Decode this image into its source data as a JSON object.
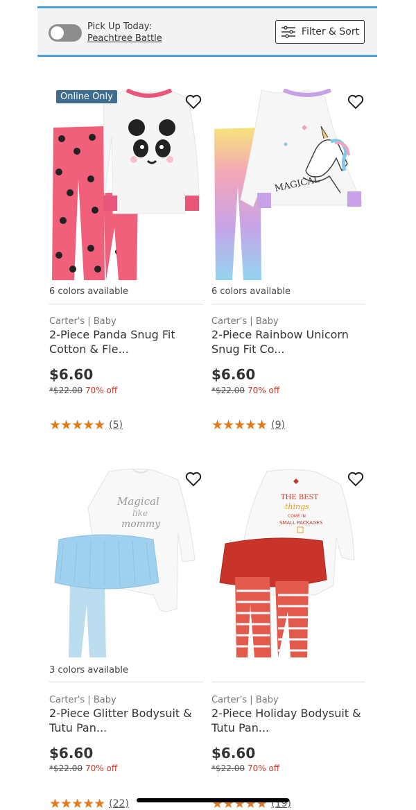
{
  "filter_bar": {
    "pickup_label": "Pick Up Today:",
    "pickup_store": "Peachtree Battle",
    "filter_label": "Filter & Sort"
  },
  "products": [
    {
      "badge": "Online Only",
      "colors": "6 colors available",
      "brand": "Carter's | Baby",
      "title": "2-Piece Panda Snug Fit Cotton & Fle...",
      "price": "$6.60",
      "was": "*$22.00",
      "off": "70% off",
      "stars": "★★★★★",
      "count": "(5)"
    },
    {
      "badge": "",
      "colors": "6 colors available",
      "brand": "Carter's | Baby",
      "title": "2-Piece Rainbow Unicorn Snug Fit Co...",
      "price": "$6.60",
      "was": "*$22.00",
      "off": "70% off",
      "stars": "★★★★★",
      "count": "(9)"
    },
    {
      "badge": "",
      "colors": "3 colors available",
      "brand": "Carter's | Baby",
      "title": "2-Piece Glitter Bodysuit & Tutu Pan...",
      "price": "$6.60",
      "was": "*$22.00",
      "off": "70% off",
      "stars": "★★★★★",
      "count": "(22)",
      "graphic_text": "Magical like mommy"
    },
    {
      "badge": "",
      "colors": "",
      "brand": "Carter's | Baby",
      "title": "2-Piece Holiday Bodysuit & Tutu Pan...",
      "price": "$6.60",
      "was": "*$22.00",
      "off": "70% off",
      "stars": "★★★★★",
      "count": "(19)",
      "graphic_text": "THE BEST things COME IN SMALL PACKAGES"
    }
  ],
  "colors": {
    "accent_blue": "#4da3dd",
    "badge": "#3e6d8d",
    "discount_red": "#c63b2b",
    "star_orange": "#e07c1f"
  }
}
